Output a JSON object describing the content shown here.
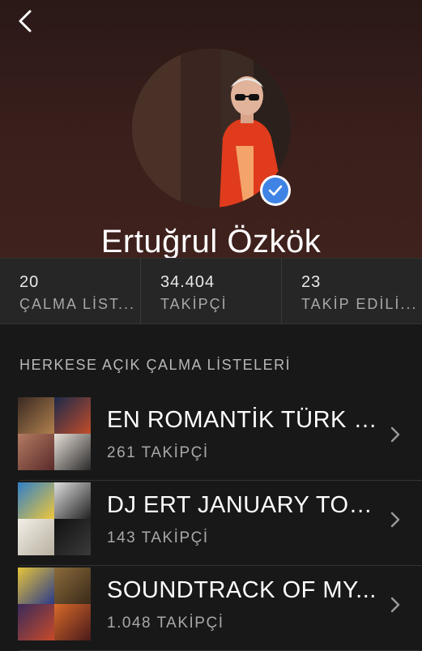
{
  "profile": {
    "name": "Ertuğrul Özkök"
  },
  "stats": [
    {
      "value": "20",
      "label": "ÇALMA LİST..."
    },
    {
      "value": "34.404",
      "label": "TAKİPÇİ"
    },
    {
      "value": "23",
      "label": "TAKİP EDİLİ..."
    }
  ],
  "section": {
    "title": "HERKESE AÇIK ÇALMA LİSTELERİ"
  },
  "playlists": [
    {
      "title": "EN ROMANTİK TÜRK Ş...",
      "followers": "261 TAKİPÇİ"
    },
    {
      "title": "DJ ERT JANUARY TOP...",
      "followers": "143 TAKİPÇİ"
    },
    {
      "title": "SOUNDTRACK OF MY...",
      "followers": "1.048 TAKİPÇİ"
    }
  ],
  "colors": {
    "background": "#181818",
    "header": "#3a1f1c",
    "verified": "#3f84e5"
  }
}
